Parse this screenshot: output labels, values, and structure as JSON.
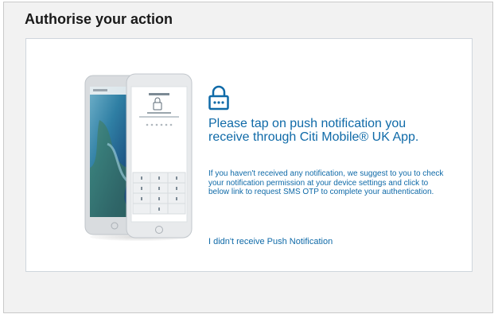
{
  "dialog": {
    "title": "Authorise your action"
  },
  "content": {
    "headline": "Please tap on push notification you receive through Citi Mobile® UK App.",
    "info": "If you haven't received any notification, we suggest to you to check your notification permission at your device settings and click to below link to request SMS OTP to complete your authentication.",
    "sms_link": "I didn't receive Push Notification"
  },
  "icons": {
    "lock": "lock-icon"
  },
  "colors": {
    "accent": "#0f6aa8",
    "dialog_bg": "#f2f2f2"
  }
}
